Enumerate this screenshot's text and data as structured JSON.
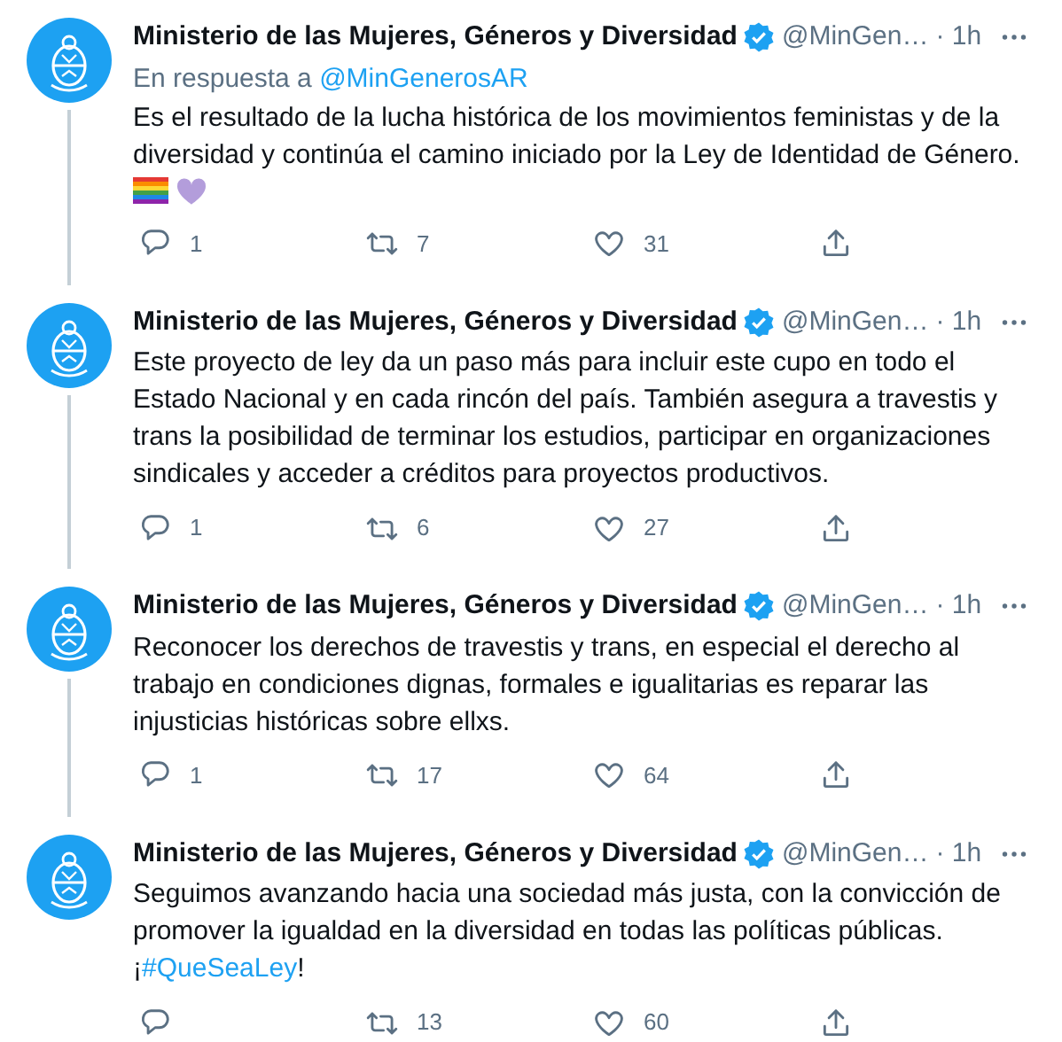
{
  "tweets": [
    {
      "name": "Ministerio de las Mujeres, Géneros y Diversidad",
      "verified": true,
      "handle": "@MinGen…",
      "time": "· 1h",
      "reply_to": {
        "label": "En respuesta a",
        "mention": "@MinGenerosAR"
      },
      "thread_continues": true,
      "body": [
        {
          "kind": "text",
          "text": "Es el resultado de la lucha histórica de los movimientos feministas y de la diversidad y continúa el camino iniciado por la Ley de Identidad de Género."
        }
      ],
      "emoji": [
        {
          "kind": "rainbow-flag"
        },
        {
          "kind": "purple-heart"
        }
      ],
      "replies": "1",
      "retweets": "7",
      "likes": "31"
    },
    {
      "name": "Ministerio de las Mujeres, Géneros y Diversidad",
      "verified": true,
      "handle": "@MinGen…",
      "time": "· 1h",
      "thread_continues": true,
      "body": [
        {
          "kind": "text",
          "text": "Este proyecto de ley da un paso más para incluir este cupo en todo el Estado Nacional y en cada rincón del país. También asegura a travestis y trans la posibilidad de terminar los estudios, participar en organizaciones sindicales y acceder a créditos para proyectos productivos."
        }
      ],
      "replies": "1",
      "retweets": "6",
      "likes": "27"
    },
    {
      "name": "Ministerio de las Mujeres, Géneros y Diversidad",
      "verified": true,
      "handle": "@MinGen…",
      "time": "· 1h",
      "thread_continues": true,
      "body": [
        {
          "kind": "text",
          "text": "Reconocer los derechos de travestis y trans, en especial el derecho al trabajo en condiciones dignas, formales e igualitarias es reparar las injusticias históricas sobre ellxs."
        }
      ],
      "replies": "1",
      "retweets": "17",
      "likes": "64"
    },
    {
      "name": "Ministerio de las Mujeres, Géneros y Diversidad",
      "verified": true,
      "handle": "@MinGen…",
      "time": "· 1h",
      "thread_continues": false,
      "body": [
        {
          "kind": "text",
          "text": "Seguimos avanzando hacia una sociedad más justa, con la convicción de promover la igualdad en la diversidad en todas las políticas públicas."
        },
        {
          "kind": "break"
        },
        {
          "kind": "text",
          "text": "¡"
        },
        {
          "kind": "hashtag",
          "text": "#QueSeaLey"
        },
        {
          "kind": "text",
          "text": "!"
        }
      ],
      "retweets": "13",
      "likes": "60"
    }
  ]
}
